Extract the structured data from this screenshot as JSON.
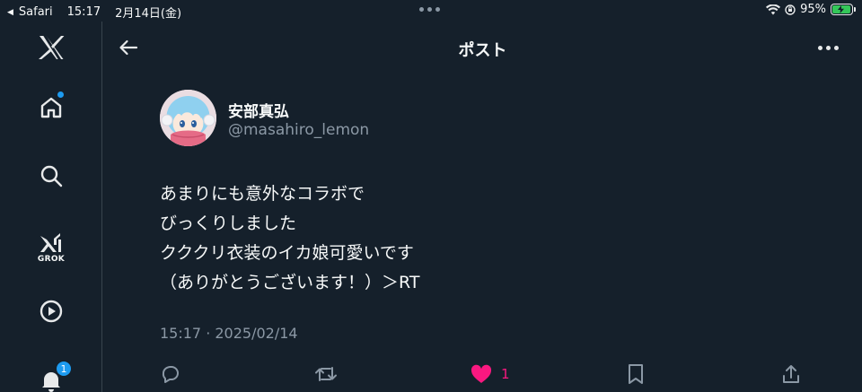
{
  "status_bar": {
    "back_app": "Safari",
    "time": "15:17",
    "date": "2月14日(金)",
    "battery": "95%",
    "battery_level": 0.95
  },
  "sidebar": {
    "grok_label": "GROK",
    "notifications_count": "1"
  },
  "header": {
    "title": "ポスト"
  },
  "post": {
    "author_name": "安部真弘",
    "author_handle": "@masahiro_lemon",
    "lines": [
      "あまりにも意外なコラボで",
      "びっくりしました",
      "クククリ衣装のイカ娘可愛いです",
      "（ありがとうございます！）＞RT"
    ],
    "timestamp": "15:17 · 2025/02/14",
    "like_count": "1"
  },
  "colors": {
    "background": "#15202b",
    "accent": "#1d9bf0",
    "like": "#f91880",
    "muted": "#8b98a5",
    "battery": "#34c759"
  },
  "icons": [
    "x-logo-icon",
    "home-icon",
    "search-icon",
    "grok-icon",
    "video-icon",
    "notifications-icon",
    "back-arrow-icon",
    "more-icon",
    "reply-icon",
    "repost-icon",
    "heart-icon",
    "bookmark-icon",
    "share-icon",
    "wifi-icon",
    "orientation-lock-icon",
    "battery-icon"
  ]
}
